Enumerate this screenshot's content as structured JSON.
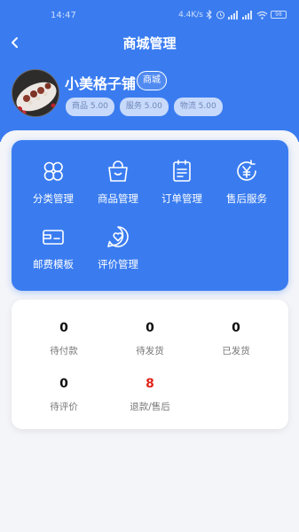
{
  "status_bar": {
    "time": "14:47",
    "network_speed": "4.4K/s",
    "battery": "98"
  },
  "header": {
    "title": "商城管理"
  },
  "shop": {
    "name": "小美格子铺",
    "tag": "商城",
    "ratings": [
      {
        "label": "商品 5.00"
      },
      {
        "label": "服务 5.00"
      },
      {
        "label": "物流 5.00"
      }
    ]
  },
  "menu": {
    "items": [
      {
        "label": "分类管理",
        "icon": "category-icon"
      },
      {
        "label": "商品管理",
        "icon": "shopping-bag-icon"
      },
      {
        "label": "订单管理",
        "icon": "order-list-icon"
      },
      {
        "label": "售后服务",
        "icon": "yuan-refund-icon"
      },
      {
        "label": "邮费模板",
        "icon": "postage-icon"
      },
      {
        "label": "评价管理",
        "icon": "review-heart-icon"
      }
    ]
  },
  "orders": {
    "stats": [
      {
        "value": "0",
        "label": "待付款"
      },
      {
        "value": "0",
        "label": "待发货"
      },
      {
        "value": "0",
        "label": "已发货"
      },
      {
        "value": "0",
        "label": "待评价"
      },
      {
        "value": "8",
        "label": "退款/售后"
      }
    ]
  },
  "colors": {
    "primary": "#3a7cf0",
    "background": "#f4f5f9",
    "alert": "#e0251b"
  }
}
